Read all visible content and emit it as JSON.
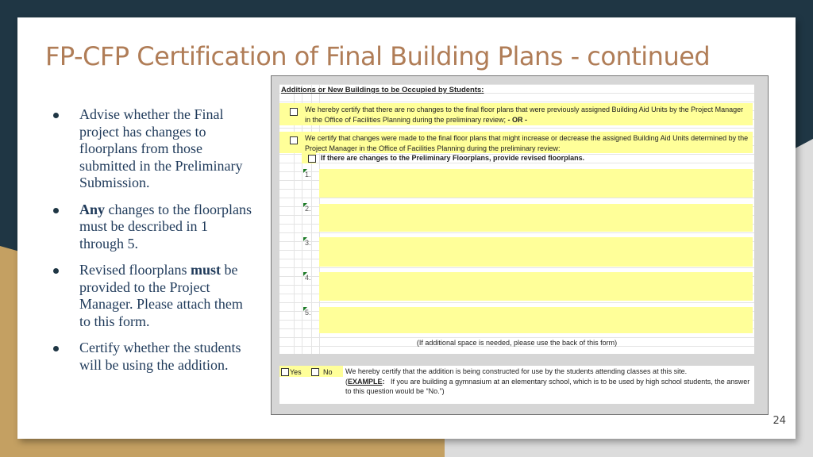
{
  "slide": {
    "title": "FP-CFP Certification of Final Building Plans - continued",
    "page_number": "24",
    "bullets": [
      {
        "pre": "Advise whether the Final project has changes to floorplans from those submitted in the Preliminary Submission.",
        "bold": "",
        "post": ""
      },
      {
        "pre": "",
        "bold": "Any",
        "post": " changes to the floorplans must be described in 1 through 5."
      },
      {
        "pre": "Revised floorplans ",
        "bold": "must",
        "post": " be provided to the Project Manager. Please attach them to this form."
      },
      {
        "pre": "Certify whether the students will be using the addition.",
        "bold": "",
        "post": ""
      }
    ]
  },
  "form": {
    "heading": "Additions or New Buildings to be Occupied by Students",
    "heading_colon": ":",
    "option1_text": "We hereby certify that there are no changes to the final floor plans that were previously assigned Building Aid Units by the Project Manager in the Office of Facilities Planning during the preliminary review;",
    "option1_or": " - OR -",
    "option2_text": "We certify that changes were made to the final floor plans that might increase or decrease the assigned Building Aid Units determined by the Project Manager in the Office of Facilities Planning during the preliminary review:",
    "sub_option_text": "If there are changes to the Preliminary Floorplans, provide revised floorplans.",
    "answer_numbers": [
      "1.",
      "2.",
      "3.",
      "4.",
      "5."
    ],
    "additional_space_note": "(If additional space is needed, please use the back of this form)",
    "yes_label": "Yes",
    "no_label": "No",
    "certify_text": "We hereby certify that the addition is being constructed for use by the students attending classes at this site.",
    "example_label": "EXAMPLE",
    "example_text": "If you are building a gymnasium at an elementary school, which is to be used by high school students, the answer to this question would be “No.”)"
  }
}
